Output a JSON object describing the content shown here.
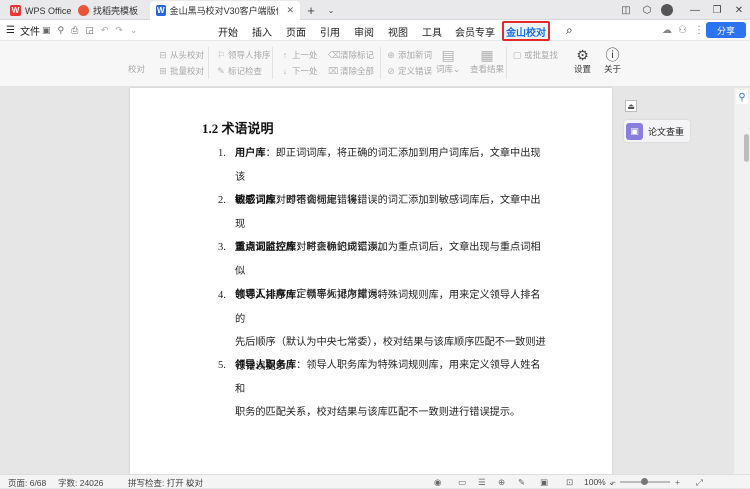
{
  "tabs": [
    {
      "label": "WPS Office",
      "logo": "W"
    },
    {
      "label": "找稻壳模板"
    },
    {
      "label": "金山黑马校对V30客户端版使用",
      "logo": "W"
    }
  ],
  "menu": {
    "file": "文件",
    "tabs": [
      "开始",
      "插入",
      "页面",
      "引用",
      "审阅",
      "视图",
      "工具",
      "会员专享",
      "金山校对"
    ],
    "share": "分享"
  },
  "ribbon": {
    "proof": "校对",
    "from_head": "从头校对",
    "batch": "批量校对",
    "leader_sort": "领导人排序",
    "mark_check": "标记检查",
    "prev": "上一处",
    "next": "下一处",
    "clear_mark": "清除标记",
    "clear_all": "清除全部",
    "add_word": "添加新词",
    "define_error": "定义错误",
    "lexicon": "词库",
    "view_result": "查看结果",
    "approve": "或批复找",
    "settings": "设置",
    "about": "关于"
  },
  "doc": {
    "heading": "1.2 术语说明",
    "items": [
      {
        "num": "1.",
        "term": "用户库",
        "l1": "：即正词词库，将正确的词汇添加到用户词库后，文章中出现该",
        "l2": "词汇，校对时不会标记错误。"
      },
      {
        "num": "2.",
        "term": "敏感词库",
        "l1": "：即错词词库，将错误的词汇添加到敏感词库后，文章中出现",
        "l2": "该词汇时，校对时会标记成错误。"
      },
      {
        "num": "3.",
        "term": "重点词监控库",
        "l1": "：将正确的词汇添加为重点词后，文章出现与重点词相似",
        "l2": "的词汇，有一定概率标记为错误。"
      },
      {
        "num": "4.",
        "term": "领导人排序库",
        "l1": "：领导人排序库为特殊词规则库，用来定义领导人排名的",
        "l2": "先后顺序（默认为中央七常委），校对结果与该库顺序匹配不一致则进",
        "l3": "行错误提示。"
      },
      {
        "num": "5.",
        "term": "领导人职务库",
        "l1": "：领导人职务库为特殊词规则库，用来定义领导人姓名和",
        "l2": "职务的匹配关系，校对结果与该库匹配不一致则进行错误提示。"
      }
    ]
  },
  "side": {
    "paper_check": "论文查重"
  },
  "status": {
    "page": "页面: 6/68",
    "words": "字数: 24026",
    "spell": "拼写检查: 打开",
    "proof": "校对",
    "zoom": "100%"
  }
}
